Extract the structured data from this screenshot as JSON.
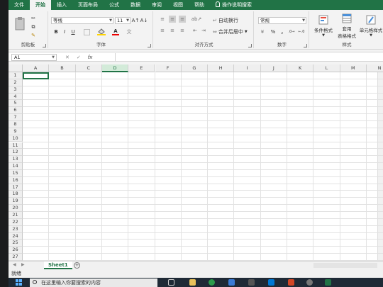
{
  "ribbon": {
    "tabs": [
      "文件",
      "开始",
      "插入",
      "页面布局",
      "公式",
      "数据",
      "审阅",
      "视图",
      "帮助",
      "操作说明搜索"
    ],
    "active_tab": "开始",
    "clipboard_label": "剪贴板",
    "font_label": "字体",
    "font_name": "等线",
    "font_size": "11",
    "bold": "B",
    "italic": "I",
    "underline": "U",
    "font_color_glyph": "A",
    "align_label": "对齐方式",
    "wrap_text": "自动换行",
    "merge_center": "合并后居中",
    "number_label": "数字",
    "number_format": "常规",
    "percent": "%",
    "comma": ",",
    "styles_label": "样式",
    "cond_format": "条件格式",
    "table_format_1": "套用",
    "table_format_2": "表格格式",
    "cell_styles": "单元格样式"
  },
  "formula_bar": {
    "name_box": "A1",
    "cancel": "✕",
    "enter": "✓",
    "fx": "fx",
    "value": ""
  },
  "grid": {
    "columns": [
      "A",
      "B",
      "C",
      "D",
      "E",
      "F",
      "G",
      "H",
      "I",
      "J",
      "K",
      "L",
      "M",
      "N"
    ],
    "selected_column": "D",
    "rows": [
      "1",
      "2",
      "3",
      "4",
      "5",
      "6",
      "7",
      "8",
      "9",
      "10",
      "11",
      "12",
      "13",
      "14",
      "15",
      "16",
      "17",
      "18",
      "19",
      "20",
      "21",
      "22",
      "23",
      "24",
      "25",
      "26",
      "27"
    ],
    "active_cell": "A1"
  },
  "sheets": {
    "tabs": [
      "Sheet1"
    ],
    "add": "+"
  },
  "status": {
    "text": "就绪"
  },
  "taskbar": {
    "search_placeholder": "在这里输入你要搜索的内容"
  },
  "colors": {
    "accent": "#217346",
    "taskbar": "#1f2a36"
  }
}
